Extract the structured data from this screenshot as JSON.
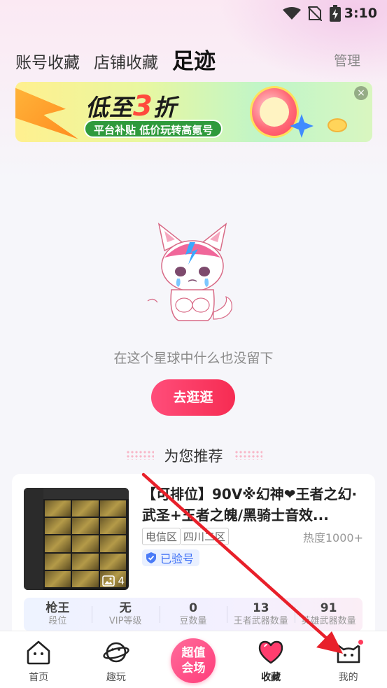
{
  "status_bar": {
    "time": "3:10"
  },
  "tabs": [
    {
      "label": "账号收藏",
      "active": false
    },
    {
      "label": "店铺收藏",
      "active": false
    },
    {
      "label": "足迹",
      "active": true
    }
  ],
  "header": {
    "manage_label": "管理"
  },
  "banner": {
    "headline_prefix": "低至",
    "headline_number": "3",
    "headline_suffix": "折",
    "subline": "平台补贴 低价玩转高氪号",
    "close_symbol": "×"
  },
  "empty_state": {
    "message": "在这个星球中什么也没留下",
    "button_label": "去逛逛"
  },
  "recommend": {
    "title": "为您推荐",
    "card": {
      "title": "【可排位】90V※幻神❤王者之幻·武圣+王者之魄/黑骑士音效...",
      "tags": [
        "电信区",
        "四川二区"
      ],
      "heat": "热度1000+",
      "verified": "已验号",
      "image_count": "4",
      "stats": [
        {
          "value": "枪王",
          "label": "段位"
        },
        {
          "value": "无",
          "label": "VIP等级"
        },
        {
          "value": "0",
          "label": "豆数量"
        },
        {
          "value": "13",
          "label": "王者武器数量"
        },
        {
          "value": "91",
          "label": "英雄武器数量"
        }
      ]
    }
  },
  "bottom_nav": [
    {
      "label": "首页",
      "icon": "home-icon"
    },
    {
      "label": "趣玩",
      "icon": "planet-icon"
    },
    {
      "label": "超值\n会场",
      "icon": "center-promo"
    },
    {
      "label": "收藏",
      "icon": "heart-icon"
    },
    {
      "label": "我的",
      "icon": "cat-face-icon"
    }
  ],
  "colors": {
    "accent": "#f62c52",
    "verified": "#3b6ef5",
    "annotation_arrow": "#e8202a"
  }
}
